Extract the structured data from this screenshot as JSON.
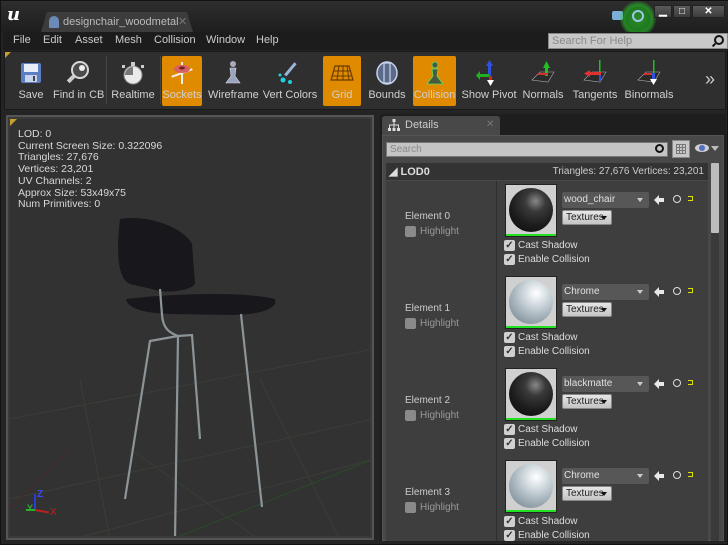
{
  "window": {
    "tab_title": "designchair_woodmetal",
    "minimize": "▁",
    "maximize": "□",
    "close": "✕"
  },
  "menu": [
    "File",
    "Edit",
    "Asset",
    "Mesh",
    "Collision",
    "Window",
    "Help"
  ],
  "help_search": {
    "placeholder": "Search For Help"
  },
  "toolbar": {
    "buttons": [
      {
        "label": "Save",
        "icon": "save-icon",
        "active": false
      },
      {
        "label": "Find in CB",
        "icon": "find-in-cb-icon",
        "active": false
      },
      {
        "label": "Realtime",
        "icon": "stopwatch-icon",
        "active": false
      },
      {
        "label": "Sockets",
        "icon": "sockets-icon",
        "active": true
      },
      {
        "label": "Wireframe",
        "icon": "wireframe-icon",
        "active": false
      },
      {
        "label": "Vert Colors",
        "icon": "vert-colors-icon",
        "active": false
      },
      {
        "label": "Grid",
        "icon": "grid-icon",
        "active": true
      },
      {
        "label": "Bounds",
        "icon": "bounds-icon",
        "active": false
      },
      {
        "label": "Collision",
        "icon": "collision-icon",
        "active": true
      },
      {
        "label": "Show Pivot",
        "icon": "pivot-icon",
        "active": false
      },
      {
        "label": "Normals",
        "icon": "normals-icon",
        "active": false
      },
      {
        "label": "Tangents",
        "icon": "tangents-icon",
        "active": false
      },
      {
        "label": "Binormals",
        "icon": "binormals-icon",
        "active": false
      }
    ],
    "more": "»",
    "active_color": "#e08a00"
  },
  "viewport": {
    "stats": [
      "LOD:  0",
      "Current Screen Size:  0.322096",
      "Triangles:  27,676",
      "Vertices:  23,201",
      "UV Channels:  2",
      "Approx Size: 53x49x75",
      "Num Primitives:  0"
    ],
    "axis": {
      "x": "X",
      "y": "Y",
      "z": "Z"
    }
  },
  "details": {
    "tab_label": "Details",
    "tab_close": "✕",
    "search_placeholder": "Search",
    "lod_title": "LOD0",
    "lod_stats": "Triangles: 27,676   Vertices: 23,201",
    "elements": [
      {
        "name": "Element 0",
        "highlight": "Highlight",
        "material": "wood_chair",
        "sphere": "dark",
        "textures": "Textures",
        "cast_shadow": "Cast Shadow",
        "enable_collision": "Enable Collision"
      },
      {
        "name": "Element 1",
        "highlight": "Highlight",
        "material": "Chrome",
        "sphere": "chrome",
        "textures": "Textures",
        "cast_shadow": "Cast Shadow",
        "enable_collision": "Enable Collision"
      },
      {
        "name": "Element 2",
        "highlight": "Highlight",
        "material": "blackmatte",
        "sphere": "dark",
        "textures": "Textures",
        "cast_shadow": "Cast Shadow",
        "enable_collision": "Enable Collision"
      },
      {
        "name": "Element 3",
        "highlight": "Highlight",
        "material": "Chrome",
        "sphere": "chrome",
        "textures": "Textures",
        "cast_shadow": "Cast Shadow",
        "enable_collision": "Enable Collision"
      }
    ],
    "checkmark": "✓"
  }
}
